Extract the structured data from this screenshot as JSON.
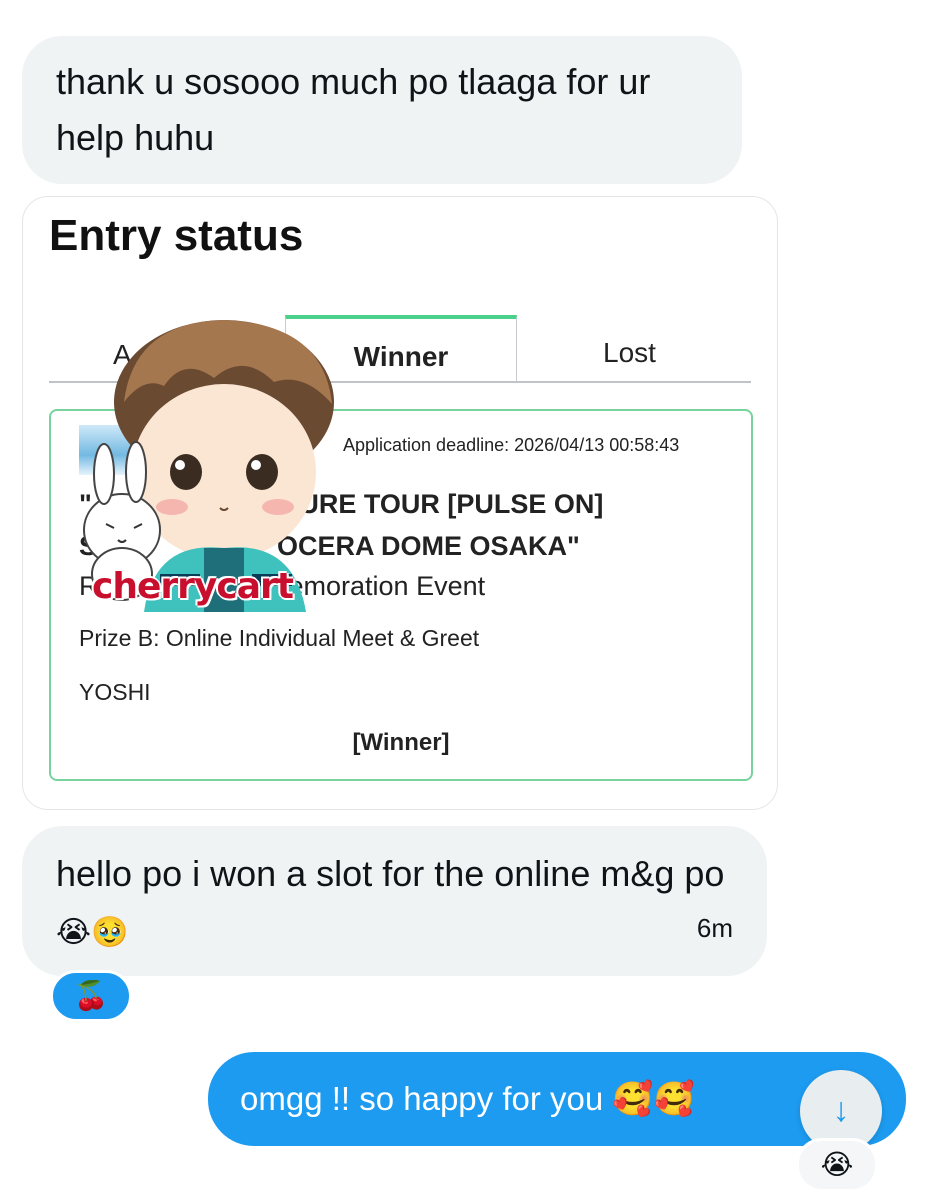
{
  "messages": {
    "msg1": "thank u sosooo much po tlaaga for ur help huhu",
    "msg2_text": "hello po i won a slot for the online m&g po",
    "msg2_emojis": "😭🥹",
    "msg2_time": "6m",
    "msg2_reaction": "🍒",
    "out_text": "omgg !! so happy for you 🥰🥰",
    "out_reaction": "😭"
  },
  "card": {
    "title": "Entry status",
    "tabs": {
      "all": "A",
      "winner": "Winner",
      "lost": "Lost"
    },
    "deadline": "Application deadline: 2026/04/13 00:58:43",
    "event_line1": "\"",
    "event_line1b": "ASURE TOUR [PULSE ON]",
    "event_line2": "S",
    "event_line2b": "OCERA DOME OSAKA\"",
    "event_line3": "R",
    "event_line3b": "emoration Event",
    "prize": "Prize B: Online Individual Meet & Greet",
    "member": "YOSHI",
    "result": "[Winner]"
  },
  "watermark": "cherrycart",
  "scroll_button_icon": "arrow-down-icon",
  "colors": {
    "accent": "#1d9bf0",
    "bubble_in": "#eff3f4",
    "tab_active": "#4cd18a",
    "entry_border": "#79d39c",
    "watermark": "#c8102e"
  }
}
